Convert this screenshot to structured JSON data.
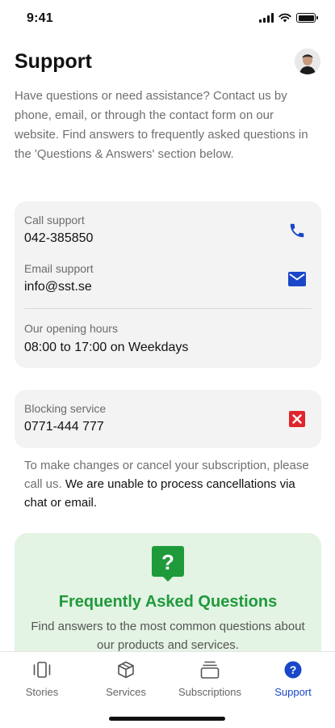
{
  "status_bar": {
    "time": "9:41"
  },
  "header": {
    "title": "Support"
  },
  "intro": "Have questions or need assistance? Contact us by phone, email, or through the contact form on our website. Find answers to frequently asked questions in the 'Questions & Answers' section below.",
  "contact": {
    "call_label": "Call support",
    "call_value": "042-385850",
    "email_label": "Email support",
    "email_value": "info@sst.se",
    "hours_label": "Our opening hours",
    "hours_value": "08:00 to 17:00 on Weekdays"
  },
  "blocking": {
    "label": "Blocking service",
    "value": "0771-444 777"
  },
  "cancel_note": {
    "part1": "To make changes or cancel your subscription, please call us. ",
    "part2": "We are unable to process cancellations via chat or email."
  },
  "faq": {
    "title": "Frequently Asked Questions",
    "description": "Find answers to the most common questions about our products and services."
  },
  "tabs": [
    {
      "label": "Stories",
      "icon": "stories-icon"
    },
    {
      "label": "Services",
      "icon": "box-icon"
    },
    {
      "label": "Subscriptions",
      "icon": "subscriptions-icon"
    },
    {
      "label": "Support",
      "icon": "question-circle-icon",
      "active": true
    }
  ],
  "colors": {
    "accent_blue": "#1947c8",
    "faq_green": "#1f9a3b",
    "faq_bg": "#e3f3e4",
    "block_red": "#e0242b",
    "card_bg": "#f3f3f3"
  }
}
